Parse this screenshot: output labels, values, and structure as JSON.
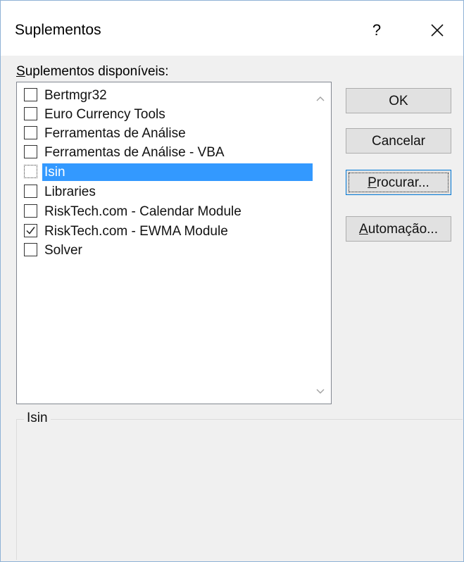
{
  "window": {
    "title": "Suplementos",
    "help_label": "?",
    "close_icon": "close-icon"
  },
  "list": {
    "label_prefix": "",
    "label_accel": "S",
    "label_rest": "uplementos disponíveis:",
    "items": [
      {
        "label": "Bertmgr32",
        "checked": false,
        "selected": false
      },
      {
        "label": "Euro Currency Tools",
        "checked": false,
        "selected": false
      },
      {
        "label": "Ferramentas de Análise",
        "checked": false,
        "selected": false
      },
      {
        "label": "Ferramentas de Análise - VBA",
        "checked": false,
        "selected": false
      },
      {
        "label": "Isin",
        "checked": false,
        "selected": true
      },
      {
        "label": "Libraries",
        "checked": false,
        "selected": false
      },
      {
        "label": "RiskTech.com - Calendar Module",
        "checked": false,
        "selected": false
      },
      {
        "label": "RiskTech.com - EWMA Module",
        "checked": true,
        "selected": false
      },
      {
        "label": "Solver",
        "checked": false,
        "selected": false
      }
    ]
  },
  "buttons": {
    "ok": "OK",
    "cancel": "Cancelar",
    "browse_accel": "P",
    "browse_rest": "rocurar...",
    "automation_accel": "A",
    "automation_rest": "utomação..."
  },
  "description": {
    "group_label": "Isin"
  },
  "colors": {
    "selection": "#3399ff",
    "focus_border": "#0078d7"
  }
}
